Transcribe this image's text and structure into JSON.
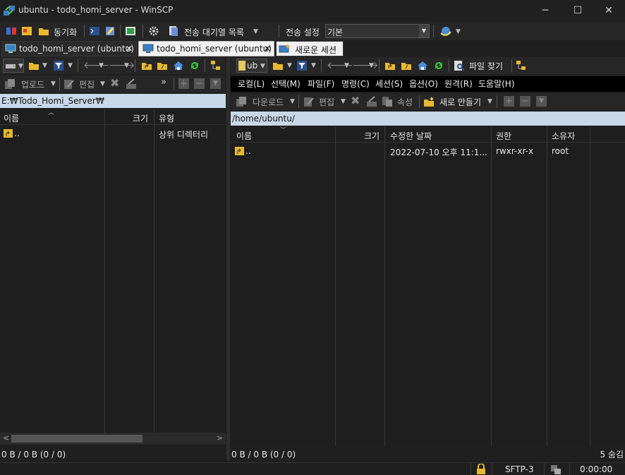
{
  "window": {
    "title": "ubuntu - todo_homi_server - WinSCP",
    "minimize": "─",
    "maximize": "☐",
    "close": "✕"
  },
  "toolbar_main": {
    "sync_label": "동기화",
    "queue_label": "전송 대기열 목록",
    "transfer_settings_label": "전송 설정",
    "transfer_preset_value": "기본"
  },
  "tabs": [
    {
      "label": "todo_homi_server (ubuntu)",
      "close": "✕"
    },
    {
      "label": "todo_homi_server (ubuntu)",
      "close": "✕"
    },
    {
      "label": "새로운 세션"
    }
  ],
  "left_panel": {
    "toolbar": {
      "upload_label": "업로드",
      "edit_label": "편집"
    },
    "path": "E:₩Todo_Homi_Server₩",
    "columns": {
      "name": "이름",
      "size": "크기",
      "type": "유형"
    },
    "rows": [
      {
        "name": "..",
        "type": "상위 디렉터리"
      }
    ],
    "status": "0 B / 0 B (0 / 0)"
  },
  "right_panel": {
    "drive_value": "ub",
    "find_files_label": "파일 찾기",
    "menu": [
      "로컬(L)",
      "선택(M)",
      "파일(F)",
      "명령(C)",
      "세션(S)",
      "옵션(O)",
      "원격(R)",
      "도움말(H)"
    ],
    "toolbar": {
      "download_label": "다운로드",
      "edit_label": "편집",
      "properties_label": "속성",
      "new_label": "새로 만들기"
    },
    "path": "/home/ubuntu/",
    "columns": {
      "name": "이름",
      "size": "크기",
      "modified": "수정한 날짜",
      "rights": "권한",
      "owner": "소유자"
    },
    "rows": [
      {
        "name": "..",
        "modified": "2022-07-10 오후 11:1...",
        "rights": "rwxr-xr-x",
        "owner": "root"
      }
    ],
    "status": "0 B / 0 B (0 / 0)",
    "hidden_count": "5 숨김"
  },
  "statusbar": {
    "protocol": "SFTP-3",
    "time": "0:00:00"
  },
  "colors": {
    "accent": "#c8d8e8",
    "folder": "#e8b830",
    "refresh": "#3cbf3c"
  }
}
